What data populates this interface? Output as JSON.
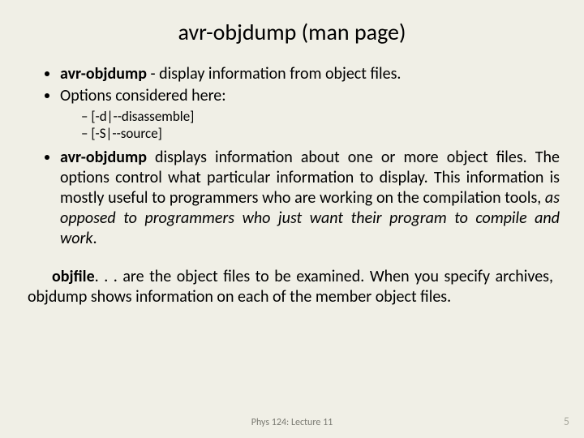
{
  "title": "avr-objdump (man page)",
  "bullets": {
    "b1_bold": "avr-objdump",
    "b1_rest": " - display information from object files.",
    "b2": "Options considered here:",
    "sub1": "[-d|--disassemble]",
    "sub2": "[-S|--source]",
    "b3_bold": "avr-objdump",
    "b3_mid": "  displays  information  about  one  or  more object files.  The options control what particular information to display.  This  information is mostly useful to programmers who are working on the compilation tools, ",
    "b3_italic": "as opposed to programmers who just want their program to compile and work",
    "b3_end": "."
  },
  "para2": {
    "bold": "objfile",
    "rest": ". . . are  the  object  files  to  be examined.  When you specify archives, objdump shows information on each of the member object files."
  },
  "footer": {
    "center": "Phys 124: Lecture 11",
    "page": "5"
  }
}
